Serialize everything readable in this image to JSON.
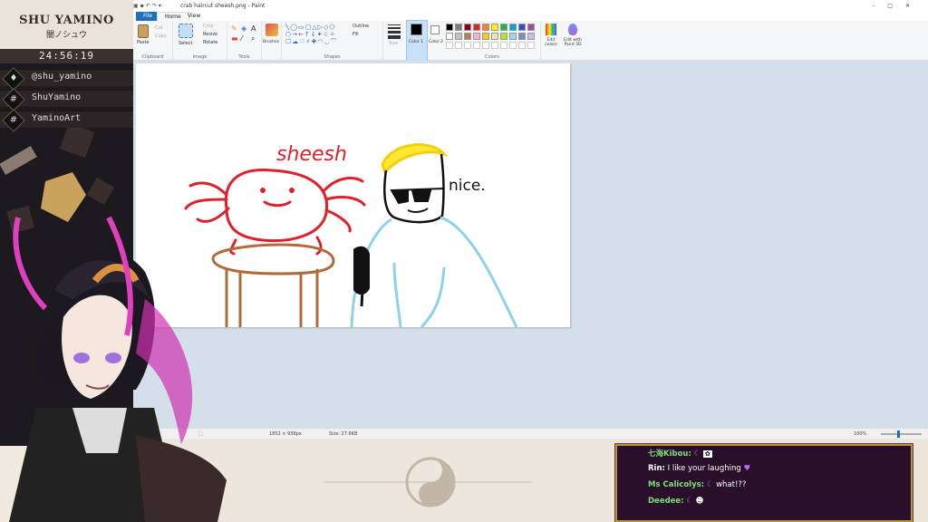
{
  "brand": {
    "name": "SHU YAMINO",
    "subtitle": "闇ノシュウ"
  },
  "clock": "24:56:19",
  "socials": [
    {
      "icon": "twitter-icon",
      "text": "@shu_yamino"
    },
    {
      "icon": "hashtag-icon",
      "text": "ShuYamino"
    },
    {
      "icon": "hashtag-icon",
      "text": "YaminoArt"
    }
  ],
  "window": {
    "title": "crab haircut sheesh.png - Paint"
  },
  "tabs": {
    "file": "File",
    "home": "Home",
    "view": "View"
  },
  "ribbon": {
    "clipboard": {
      "label": "Clipboard",
      "paste": "Paste",
      "cut": "Cut",
      "copy": "Copy"
    },
    "image": {
      "label": "Image",
      "select": "Select",
      "crop": "Crop",
      "resize": "Resize",
      "rotate": "Rotate"
    },
    "tools": {
      "label": "Tools"
    },
    "brushes": {
      "label": "Brushes"
    },
    "shapes": {
      "label": "Shapes",
      "outline": "Outline",
      "fill": "Fill"
    },
    "size": {
      "label": "Size"
    },
    "color1": {
      "label": "Color 1"
    },
    "color2": {
      "label": "Color 2"
    },
    "colors": {
      "label": "Colors"
    },
    "edit_colors": "Edit colors",
    "paint3d": "Edit with Paint 3D"
  },
  "palette": [
    "#000000",
    "#7f7f7f",
    "#880015",
    "#ed1c24",
    "#ff7f27",
    "#fff200",
    "#22b14c",
    "#00a2e8",
    "#3f48cc",
    "#a349a4",
    "#ffffff",
    "#c3c3c3",
    "#b97a57",
    "#ffaec9",
    "#ffc90e",
    "#efe4b0",
    "#b5e61d",
    "#99d9ea",
    "#7092be",
    "#c8bfe7"
  ],
  "drawing": {
    "text_sheesh": "sheesh",
    "text_nice": "nice."
  },
  "status": {
    "dimensions": "1852 × 938px",
    "size": "Size: 27.6KB",
    "zoom": "100%"
  },
  "chat": [
    {
      "user": "七海Kibou:",
      "text": "",
      "color": "#7be07b"
    },
    {
      "user": "Rin:",
      "text": "I like your laughing",
      "color": "#ffffff"
    },
    {
      "user": "Ms Calicolys:",
      "text": "what!??",
      "color": "#7be07b"
    },
    {
      "user": "Deedee:",
      "text": "",
      "color": "#7be07b"
    }
  ]
}
